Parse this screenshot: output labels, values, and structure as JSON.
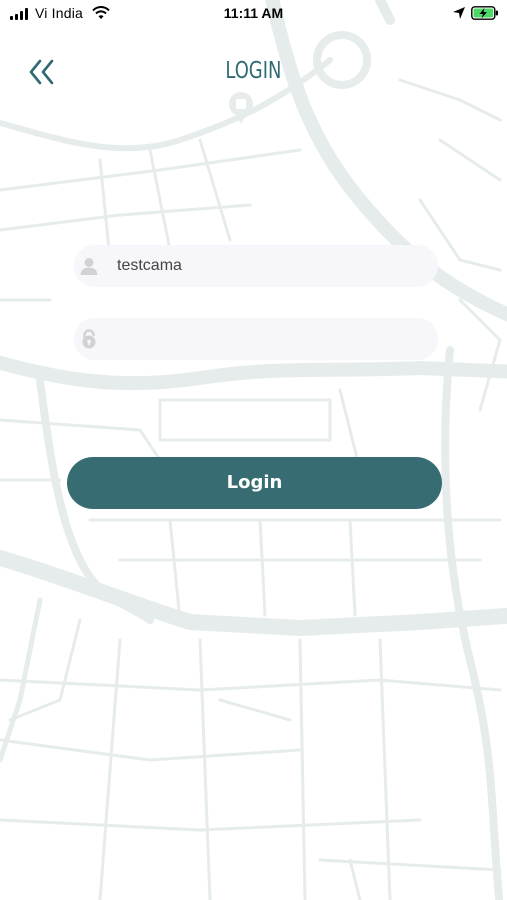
{
  "status_bar": {
    "carrier": "Vi India",
    "time": "11:11 AM",
    "signal_icon": "signal-bars-icon",
    "wifi_icon": "wifi-icon",
    "location_icon": "location-arrow-icon",
    "battery_icon": "battery-charging-icon"
  },
  "header": {
    "title": "LOGIN",
    "back_icon": "double-chevron-left-icon"
  },
  "form": {
    "username": {
      "value": "testcama",
      "placeholder": "",
      "icon": "user-icon"
    },
    "password": {
      "value": "",
      "placeholder": "",
      "icon": "lock-icon"
    },
    "login_label": "Login"
  },
  "colors": {
    "accent": "#376c73",
    "title": "#2f6a73",
    "field_bg": "#f7f7fb",
    "map_lines": "#e4eaea",
    "battery_fill": "#4cd964"
  }
}
